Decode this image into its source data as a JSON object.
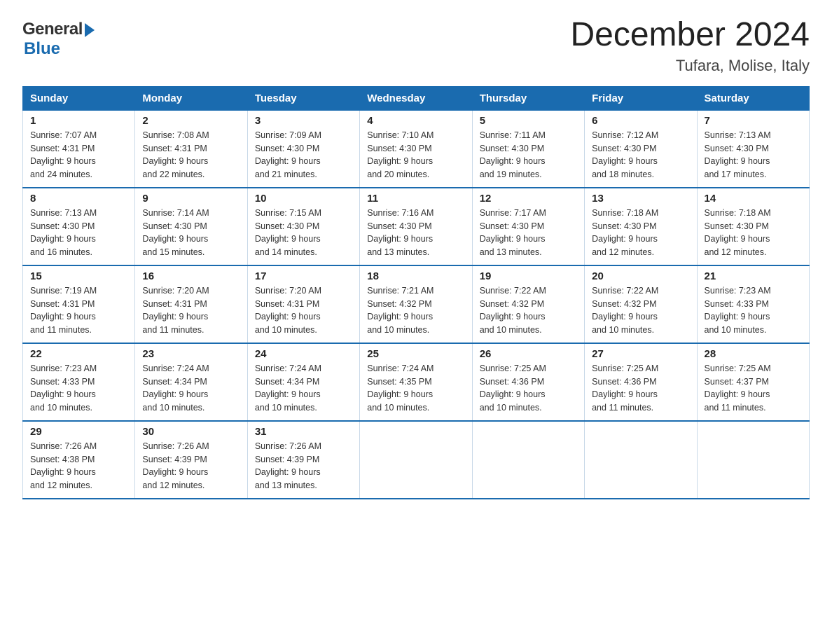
{
  "header": {
    "title": "December 2024",
    "location": "Tufara, Molise, Italy",
    "logo_general": "General",
    "logo_blue": "Blue"
  },
  "calendar": {
    "days_of_week": [
      "Sunday",
      "Monday",
      "Tuesday",
      "Wednesday",
      "Thursday",
      "Friday",
      "Saturday"
    ],
    "weeks": [
      [
        {
          "day": "1",
          "sunrise": "7:07 AM",
          "sunset": "4:31 PM",
          "daylight": "9 hours and 24 minutes."
        },
        {
          "day": "2",
          "sunrise": "7:08 AM",
          "sunset": "4:31 PM",
          "daylight": "9 hours and 22 minutes."
        },
        {
          "day": "3",
          "sunrise": "7:09 AM",
          "sunset": "4:30 PM",
          "daylight": "9 hours and 21 minutes."
        },
        {
          "day": "4",
          "sunrise": "7:10 AM",
          "sunset": "4:30 PM",
          "daylight": "9 hours and 20 minutes."
        },
        {
          "day": "5",
          "sunrise": "7:11 AM",
          "sunset": "4:30 PM",
          "daylight": "9 hours and 19 minutes."
        },
        {
          "day": "6",
          "sunrise": "7:12 AM",
          "sunset": "4:30 PM",
          "daylight": "9 hours and 18 minutes."
        },
        {
          "day": "7",
          "sunrise": "7:13 AM",
          "sunset": "4:30 PM",
          "daylight": "9 hours and 17 minutes."
        }
      ],
      [
        {
          "day": "8",
          "sunrise": "7:13 AM",
          "sunset": "4:30 PM",
          "daylight": "9 hours and 16 minutes."
        },
        {
          "day": "9",
          "sunrise": "7:14 AM",
          "sunset": "4:30 PM",
          "daylight": "9 hours and 15 minutes."
        },
        {
          "day": "10",
          "sunrise": "7:15 AM",
          "sunset": "4:30 PM",
          "daylight": "9 hours and 14 minutes."
        },
        {
          "day": "11",
          "sunrise": "7:16 AM",
          "sunset": "4:30 PM",
          "daylight": "9 hours and 13 minutes."
        },
        {
          "day": "12",
          "sunrise": "7:17 AM",
          "sunset": "4:30 PM",
          "daylight": "9 hours and 13 minutes."
        },
        {
          "day": "13",
          "sunrise": "7:18 AM",
          "sunset": "4:30 PM",
          "daylight": "9 hours and 12 minutes."
        },
        {
          "day": "14",
          "sunrise": "7:18 AM",
          "sunset": "4:30 PM",
          "daylight": "9 hours and 12 minutes."
        }
      ],
      [
        {
          "day": "15",
          "sunrise": "7:19 AM",
          "sunset": "4:31 PM",
          "daylight": "9 hours and 11 minutes."
        },
        {
          "day": "16",
          "sunrise": "7:20 AM",
          "sunset": "4:31 PM",
          "daylight": "9 hours and 11 minutes."
        },
        {
          "day": "17",
          "sunrise": "7:20 AM",
          "sunset": "4:31 PM",
          "daylight": "9 hours and 10 minutes."
        },
        {
          "day": "18",
          "sunrise": "7:21 AM",
          "sunset": "4:32 PM",
          "daylight": "9 hours and 10 minutes."
        },
        {
          "day": "19",
          "sunrise": "7:22 AM",
          "sunset": "4:32 PM",
          "daylight": "9 hours and 10 minutes."
        },
        {
          "day": "20",
          "sunrise": "7:22 AM",
          "sunset": "4:32 PM",
          "daylight": "9 hours and 10 minutes."
        },
        {
          "day": "21",
          "sunrise": "7:23 AM",
          "sunset": "4:33 PM",
          "daylight": "9 hours and 10 minutes."
        }
      ],
      [
        {
          "day": "22",
          "sunrise": "7:23 AM",
          "sunset": "4:33 PM",
          "daylight": "9 hours and 10 minutes."
        },
        {
          "day": "23",
          "sunrise": "7:24 AM",
          "sunset": "4:34 PM",
          "daylight": "9 hours and 10 minutes."
        },
        {
          "day": "24",
          "sunrise": "7:24 AM",
          "sunset": "4:34 PM",
          "daylight": "9 hours and 10 minutes."
        },
        {
          "day": "25",
          "sunrise": "7:24 AM",
          "sunset": "4:35 PM",
          "daylight": "9 hours and 10 minutes."
        },
        {
          "day": "26",
          "sunrise": "7:25 AM",
          "sunset": "4:36 PM",
          "daylight": "9 hours and 10 minutes."
        },
        {
          "day": "27",
          "sunrise": "7:25 AM",
          "sunset": "4:36 PM",
          "daylight": "9 hours and 11 minutes."
        },
        {
          "day": "28",
          "sunrise": "7:25 AM",
          "sunset": "4:37 PM",
          "daylight": "9 hours and 11 minutes."
        }
      ],
      [
        {
          "day": "29",
          "sunrise": "7:26 AM",
          "sunset": "4:38 PM",
          "daylight": "9 hours and 12 minutes."
        },
        {
          "day": "30",
          "sunrise": "7:26 AM",
          "sunset": "4:39 PM",
          "daylight": "9 hours and 12 minutes."
        },
        {
          "day": "31",
          "sunrise": "7:26 AM",
          "sunset": "4:39 PM",
          "daylight": "9 hours and 13 minutes."
        },
        null,
        null,
        null,
        null
      ]
    ],
    "labels": {
      "sunrise": "Sunrise:",
      "sunset": "Sunset:",
      "daylight": "Daylight:"
    }
  }
}
